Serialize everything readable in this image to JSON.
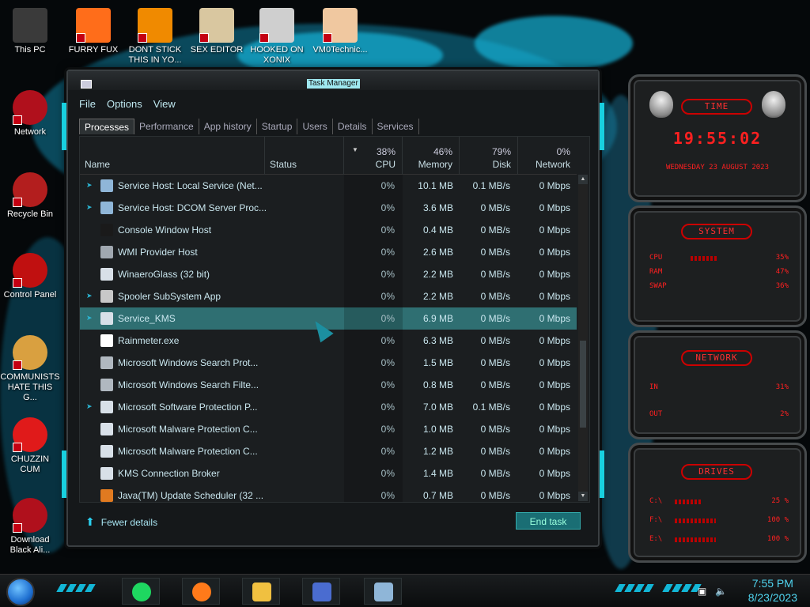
{
  "desktop": {
    "icons": [
      {
        "label": "This PC",
        "color": "#3a3a3a"
      },
      {
        "label": "FURRY FUX",
        "color": "#ff6d1a"
      },
      {
        "label": "DONT STICK THIS IN YO...",
        "color": "#f08a00"
      },
      {
        "label": "SEX EDITOR",
        "color": "#d9c7a0"
      },
      {
        "label": "HOOKED ON XONIX",
        "color": "#cfcfcf"
      },
      {
        "label": "VM0Technic...",
        "color": "#f0c8a0"
      },
      {
        "label": "Network",
        "color": "#b0101c"
      },
      {
        "label": "Recycle Bin",
        "color": "#b31e1e"
      },
      {
        "label": "Control Panel",
        "color": "#c01010"
      },
      {
        "label": "COMMUNISTS HATE THIS G...",
        "color": "#d9a040"
      },
      {
        "label": "CHUZZIN CUM",
        "color": "#e01a1a"
      },
      {
        "label": "Download Black Ali...",
        "color": "#b0101c"
      }
    ]
  },
  "task_manager": {
    "title": "Task Manager",
    "menu": [
      "File",
      "Options",
      "View"
    ],
    "tabs": [
      "Processes",
      "Performance",
      "App history",
      "Startup",
      "Users",
      "Details",
      "Services"
    ],
    "columns": {
      "name": "Name",
      "status": "Status",
      "cpu": {
        "pct": "38%",
        "label": "CPU"
      },
      "memory": {
        "pct": "46%",
        "label": "Memory"
      },
      "disk": {
        "pct": "79%",
        "label": "Disk"
      },
      "network": {
        "pct": "0%",
        "label": "Network"
      }
    },
    "rows": [
      {
        "name": "Service Host: Local Service (Net...",
        "cpu": "0%",
        "mem": "10.1 MB",
        "disk": "0.1 MB/s",
        "net": "0 Mbps",
        "expand": true,
        "icon": "#8fb6d8"
      },
      {
        "name": "Service Host: DCOM Server Proc...",
        "cpu": "0%",
        "mem": "3.6 MB",
        "disk": "0 MB/s",
        "net": "0 Mbps",
        "expand": true,
        "icon": "#8fb6d8"
      },
      {
        "name": "Console Window Host",
        "cpu": "0%",
        "mem": "0.4 MB",
        "disk": "0 MB/s",
        "net": "0 Mbps",
        "expand": false,
        "icon": "#1a1a1a"
      },
      {
        "name": "WMI Provider Host",
        "cpu": "0%",
        "mem": "2.6 MB",
        "disk": "0 MB/s",
        "net": "0 Mbps",
        "expand": false,
        "icon": "#a0a8b0"
      },
      {
        "name": "WinaeroGlass (32 bit)",
        "cpu": "0%",
        "mem": "2.2 MB",
        "disk": "0 MB/s",
        "net": "0 Mbps",
        "expand": false,
        "icon": "#d8e0e8"
      },
      {
        "name": "Spooler SubSystem App",
        "cpu": "0%",
        "mem": "2.2 MB",
        "disk": "0 MB/s",
        "net": "0 Mbps",
        "expand": true,
        "icon": "#c8c8c8"
      },
      {
        "name": "Service_KMS",
        "cpu": "0%",
        "mem": "6.9 MB",
        "disk": "0 MB/s",
        "net": "0 Mbps",
        "expand": true,
        "icon": "#d8e0e8",
        "selected": true
      },
      {
        "name": "Rainmeter.exe",
        "cpu": "0%",
        "mem": "6.3 MB",
        "disk": "0 MB/s",
        "net": "0 Mbps",
        "expand": false,
        "icon": "#ffffff"
      },
      {
        "name": "Microsoft Windows Search Prot...",
        "cpu": "0%",
        "mem": "1.5 MB",
        "disk": "0 MB/s",
        "net": "0 Mbps",
        "expand": false,
        "icon": "#b0b8c0"
      },
      {
        "name": "Microsoft Windows Search Filte...",
        "cpu": "0%",
        "mem": "0.8 MB",
        "disk": "0 MB/s",
        "net": "0 Mbps",
        "expand": false,
        "icon": "#b0b8c0"
      },
      {
        "name": "Microsoft Software Protection P...",
        "cpu": "0%",
        "mem": "7.0 MB",
        "disk": "0.1 MB/s",
        "net": "0 Mbps",
        "expand": true,
        "icon": "#d8e0e8"
      },
      {
        "name": "Microsoft Malware Protection C...",
        "cpu": "0%",
        "mem": "1.0 MB",
        "disk": "0 MB/s",
        "net": "0 Mbps",
        "expand": false,
        "icon": "#d8e0e8"
      },
      {
        "name": "Microsoft Malware Protection C...",
        "cpu": "0%",
        "mem": "1.2 MB",
        "disk": "0 MB/s",
        "net": "0 Mbps",
        "expand": false,
        "icon": "#d8e0e8"
      },
      {
        "name": "KMS Connection Broker",
        "cpu": "0%",
        "mem": "1.4 MB",
        "disk": "0 MB/s",
        "net": "0 Mbps",
        "expand": false,
        "icon": "#d8e0e8"
      },
      {
        "name": "Java(TM) Update Scheduler (32 ...",
        "cpu": "0%",
        "mem": "0.7 MB",
        "disk": "0 MB/s",
        "net": "0 Mbps",
        "expand": false,
        "icon": "#e07a20"
      }
    ],
    "footer": {
      "fewer_details": "Fewer details",
      "end_task": "End task"
    }
  },
  "gadgets": {
    "time": {
      "title": "TIME",
      "clock": "19:55:02",
      "date": "WEDNESDAY 23 AUGUST 2023"
    },
    "system": {
      "title": "SYSTEM",
      "rows": [
        {
          "label": "CPU",
          "value": "35%"
        },
        {
          "label": "RAM",
          "value": "47%"
        },
        {
          "label": "SWAP",
          "value": "36%"
        }
      ]
    },
    "network": {
      "title": "NETWORK",
      "rows": [
        {
          "label": "IN",
          "value": "31%"
        },
        {
          "label": "OUT",
          "value": "2%"
        }
      ]
    },
    "drives": {
      "title": "DRIVES",
      "rows": [
        {
          "label": "C:\\",
          "value": "25 %"
        },
        {
          "label": "F:\\",
          "value": "100 %"
        },
        {
          "label": "E:\\",
          "value": "100 %"
        }
      ]
    }
  },
  "taskbar": {
    "pins": [
      {
        "name": "spotify-icon",
        "color": "#1ed760"
      },
      {
        "name": "firefox-icon",
        "color": "#ff7a1a"
      },
      {
        "name": "file-explorer-icon",
        "color": "#f0c040"
      },
      {
        "name": "control-panel-icon",
        "color": "#4a6cd0"
      },
      {
        "name": "task-manager-icon",
        "color": "#8fb6d8"
      }
    ],
    "time": "7:55 PM",
    "date": "8/23/2023"
  }
}
